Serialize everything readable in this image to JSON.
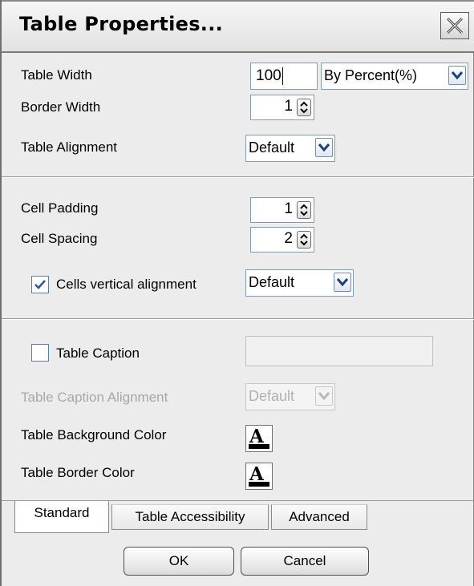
{
  "dialog": {
    "title": "Table Properties...",
    "close_icon": "close-x-icon"
  },
  "section_table": {
    "table_width_label": "Table Width",
    "table_width_value": "100",
    "table_width_unit": "By Percent(%)",
    "border_width_label": "Border Width",
    "border_width_value": "1",
    "table_alignment_label": "Table Alignment",
    "table_alignment_value": "Default"
  },
  "section_cells": {
    "cell_padding_label": "Cell Padding",
    "cell_padding_value": "1",
    "cell_spacing_label": "Cell Spacing",
    "cell_spacing_value": "2",
    "vertical_alignment_label": "Cells vertical alignment",
    "vertical_alignment_checked": true,
    "vertical_alignment_value": "Default"
  },
  "section_caption": {
    "caption_label": "Table Caption",
    "caption_checked": false,
    "caption_value": "",
    "caption_alignment_label": "Table Caption Alignment",
    "caption_alignment_value": "Default",
    "background_color_label": "Table Background Color",
    "border_color_label": "Table Border Color",
    "color_icon_letter": "A"
  },
  "tabs": [
    {
      "label": "Standard",
      "active": true
    },
    {
      "label": "Table Accessibility",
      "active": false
    },
    {
      "label": "Advanced",
      "active": false
    }
  ],
  "buttons": {
    "ok_label": "OK",
    "cancel_label": "Cancel"
  },
  "colors": {
    "dialog_bg": "#ececec",
    "disabled_text": "#a8a8a8",
    "field_border": "#7f9db9"
  }
}
